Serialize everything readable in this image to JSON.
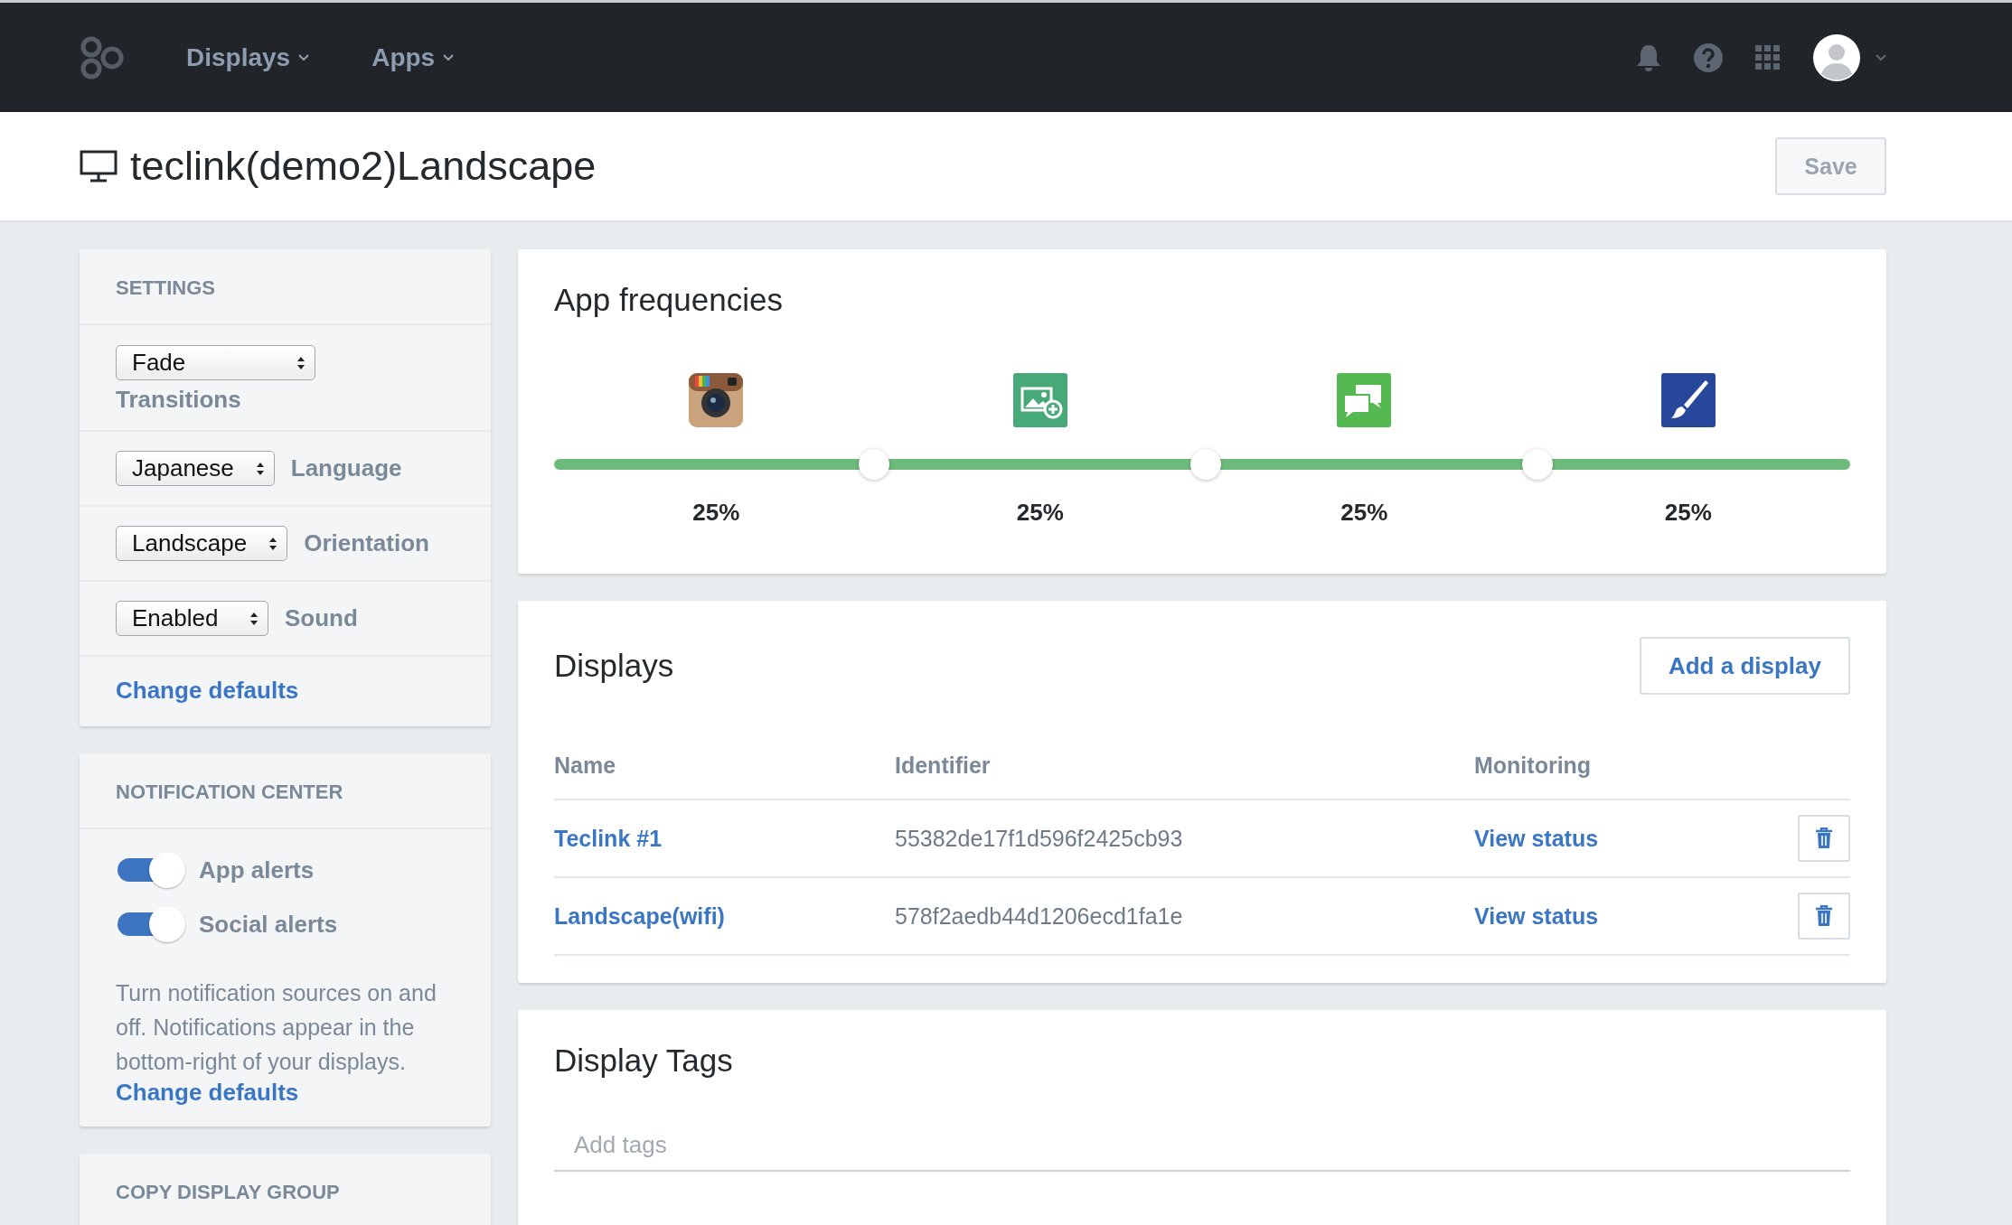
{
  "nav": {
    "items": [
      {
        "label": "Displays"
      },
      {
        "label": "Apps"
      }
    ]
  },
  "header": {
    "title": "teclink(demo2)Landscape",
    "save": "Save"
  },
  "settings": {
    "title": "SETTINGS",
    "rows": [
      {
        "value": "Fade",
        "label": "Transitions",
        "stacked": true
      },
      {
        "value": "Japanese",
        "label": "Language",
        "stacked": false
      },
      {
        "value": "Landscape",
        "label": "Orientation",
        "stacked": false
      },
      {
        "value": "Enabled",
        "label": "Sound",
        "stacked": false
      }
    ],
    "link": "Change defaults"
  },
  "notifications": {
    "title": "NOTIFICATION CENTER",
    "toggles": [
      {
        "label": "App alerts",
        "on": true
      },
      {
        "label": "Social alerts",
        "on": true
      }
    ],
    "text": "Turn notification sources on and off. Notifications appear in the bottom-right of your displays.",
    "link": "Change defaults"
  },
  "copy_group": {
    "title": "COPY DISPLAY GROUP"
  },
  "frequencies": {
    "title": "App frequencies",
    "apps": [
      {
        "kind": "camera",
        "percent": "25%"
      },
      {
        "kind": "image",
        "percent": "25%"
      },
      {
        "kind": "chat",
        "percent": "25%"
      },
      {
        "kind": "brush",
        "percent": "25%"
      }
    ],
    "handles": [
      {
        "level": 0.247
      },
      {
        "level": 0.503
      },
      {
        "level": 0.759
      }
    ]
  },
  "displays": {
    "title": "Displays",
    "add": "Add a display",
    "columns": [
      "Name",
      "Identifier",
      "Monitoring"
    ],
    "rows": [
      {
        "name": "Teclink #1",
        "identifier": "55382de17f1d596f2425cb93",
        "monitoring": "View status"
      },
      {
        "name": "Landscape(wifi)",
        "identifier": "578f2aedb44d1206ecd1fa1e",
        "monitoring": "View status"
      }
    ]
  },
  "tags": {
    "title": "Display Tags",
    "placeholder": "Add tags"
  }
}
